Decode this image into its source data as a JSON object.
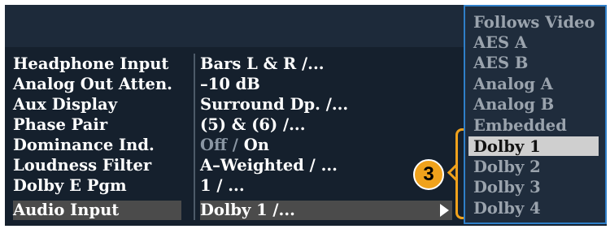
{
  "settings": [
    {
      "label": "Headphone Input",
      "value": "Bars L & R /..."
    },
    {
      "label": "Analog Out Atten.",
      "value": "–10 dB"
    },
    {
      "label": "Aux Display",
      "value": "Surround Dp. /..."
    },
    {
      "label": "Phase Pair",
      "value": "(5) & (6) /..."
    },
    {
      "label": "Dominance Ind.",
      "value_dim": "Off",
      "value_sep": " / ",
      "value": "On"
    },
    {
      "label": "Loudness Filter",
      "value": "A–Weighted / ..."
    },
    {
      "label": "Dolby E Pgm",
      "value": "1 / ..."
    },
    {
      "label": "Audio Input",
      "value": "Dolby 1 /..."
    }
  ],
  "selected_setting": "Audio Input",
  "submenu": {
    "items": [
      "Follows Video",
      "AES A",
      "AES B",
      "Analog A",
      "Analog B",
      "Embedded",
      "Dolby 1",
      "Dolby 2",
      "Dolby 3",
      "Dolby 4"
    ],
    "selected": "Dolby 1"
  },
  "callout": {
    "number": "3",
    "color": "#f0a21c"
  },
  "colors": {
    "background": "#15202d",
    "highlight_row": "#4b4b4b",
    "menu_border": "#2f7fc8"
  }
}
